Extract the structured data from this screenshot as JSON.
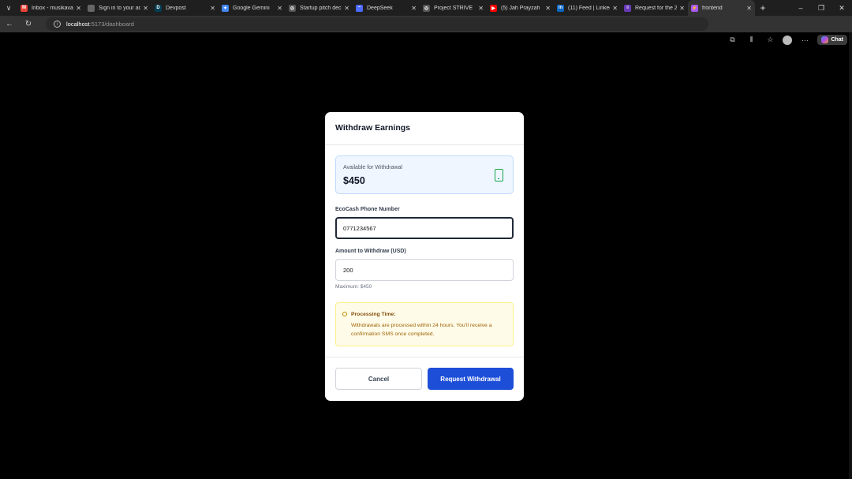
{
  "browser": {
    "tabs": [
      {
        "title": "Inbox - musikavanhu",
        "icon": "gmail-icon",
        "color": "#ea4335",
        "glyph": "M"
      },
      {
        "title": "Sign in to your account",
        "icon": "page-icon",
        "color": "#666666",
        "glyph": ""
      },
      {
        "title": "Devpost",
        "icon": "devpost-icon",
        "color": "#003e54",
        "glyph": "D"
      },
      {
        "title": "Google Gemini",
        "icon": "gemini-icon",
        "color": "#4285f4",
        "glyph": "✦"
      },
      {
        "title": "Startup pitch deck",
        "icon": "chatgpt-icon",
        "color": "#555555",
        "glyph": "◎"
      },
      {
        "title": "DeepSeek",
        "icon": "deepseek-icon",
        "color": "#4d6bfe",
        "glyph": "~"
      },
      {
        "title": "Project STRIVE",
        "icon": "chatgpt-icon",
        "color": "#555555",
        "glyph": "◎"
      },
      {
        "title": "(5) Jah Prayzah",
        "icon": "youtube-icon",
        "color": "#ff0000",
        "glyph": "▶"
      },
      {
        "title": "(11) Feed | LinkedIn",
        "icon": "linkedin-icon",
        "color": "#0a66c2",
        "glyph": "in"
      },
      {
        "title": "Request for the 2",
        "icon": "forms-icon",
        "color": "#673ab7",
        "glyph": "≡"
      },
      {
        "title": "frontend",
        "icon": "vite-icon",
        "color": "#a855f7",
        "glyph": "⚡"
      }
    ],
    "url_host": "localhost",
    "url_path": ":5173/dashboard",
    "chat_label": "Chat"
  },
  "modal": {
    "title": "Withdraw Earnings",
    "balance_label": "Available for Withdrawal",
    "balance_amount": "$450",
    "phone_label": "EcoCash Phone Number",
    "phone_value": "0771234567",
    "amount_label": "Amount to Withdraw (USD)",
    "amount_value": "200",
    "max_hint": "Maximum: $450",
    "notice_title": "Processing Time:",
    "notice_body": "Withdrawals are processed within 24 hours. You'll receive a confirmation SMS once completed.",
    "cancel_label": "Cancel",
    "submit_label": "Request Withdrawal"
  },
  "colors": {
    "primary": "#1d4ed8",
    "balance_bg": "#eff6ff",
    "phone_icon": "#16a34a",
    "notice_bg": "#fefce8"
  }
}
